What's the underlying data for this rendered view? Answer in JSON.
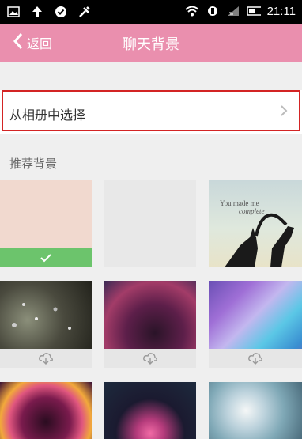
{
  "status_bar": {
    "time": "21:11"
  },
  "nav": {
    "back_label": "返回",
    "title": "聊天背景"
  },
  "album_row": {
    "label": "从相册中选择"
  },
  "section_title": "推荐背景",
  "overlay_text": {
    "line1": "You made me",
    "line2": "complete"
  },
  "colors": {
    "nav": "#ea8fae",
    "selected": "#6cc46c",
    "highlight_border": "#d32424"
  },
  "backgrounds": [
    {
      "state": "selected"
    },
    {
      "state": "none"
    },
    {
      "state": "none"
    },
    {
      "state": "download"
    },
    {
      "state": "download"
    },
    {
      "state": "download"
    },
    {
      "state": "none"
    },
    {
      "state": "none"
    },
    {
      "state": "none"
    }
  ]
}
